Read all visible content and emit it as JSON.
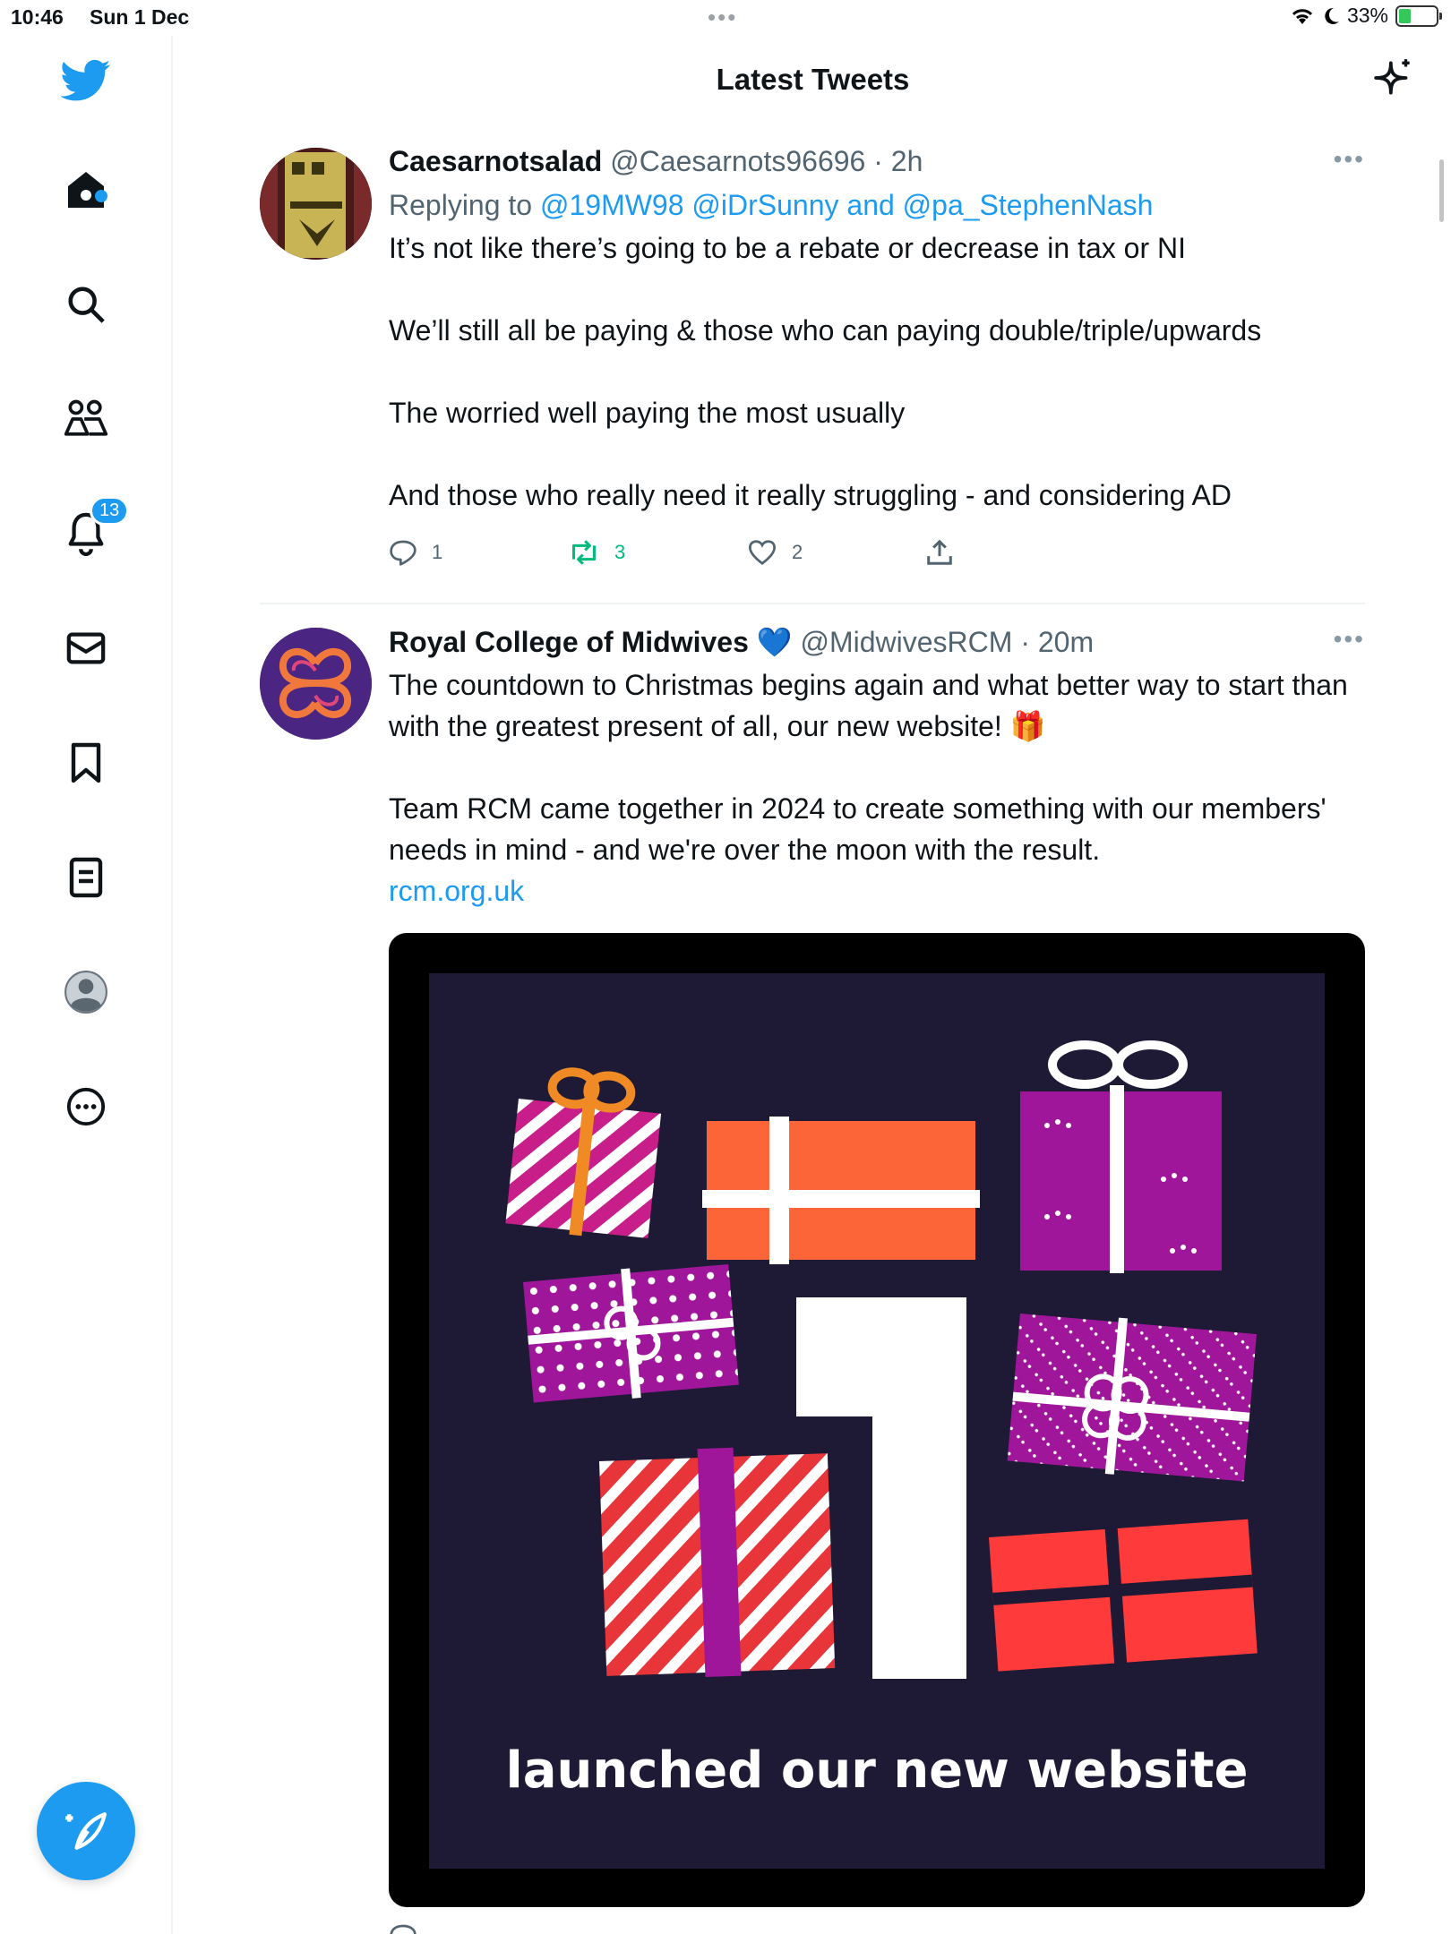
{
  "status": {
    "time": "10:46",
    "date": "Sun 1 Dec",
    "battery": "33%",
    "battery_level": 0.33
  },
  "sidebar": {
    "items": [
      {
        "icon": "twitter-logo-icon"
      },
      {
        "icon": "home-icon",
        "has_dot": true
      },
      {
        "icon": "search-icon"
      },
      {
        "icon": "communities-icon"
      },
      {
        "icon": "notifications-icon",
        "badge": "13"
      },
      {
        "icon": "messages-icon"
      },
      {
        "icon": "bookmarks-icon"
      },
      {
        "icon": "lists-icon"
      },
      {
        "icon": "profile-icon"
      },
      {
        "icon": "more-icon"
      }
    ],
    "compose_icon": "compose-tweet-icon"
  },
  "header": {
    "title": "Latest Tweets",
    "sparkle_icon": "sparkle-icon"
  },
  "tweets": [
    {
      "name": "Caesarnotsalad",
      "handle": "@Caesarnots96696",
      "time": "· 2h",
      "replying_to_prefix": "Replying to ",
      "replying_to": "@19MW98 @iDrSunny and @pa_StephenNash",
      "text": "It’s not like there’s going to be a rebate or decrease in tax or NI\n\nWe’ll still all be paying & those who can paying double/triple/upwards\n\nThe worried well paying the most usually\n\nAnd those who really need it really struggling - and considering AD",
      "replies": "1",
      "retweets": "3",
      "likes": "2"
    },
    {
      "name": "Royal College of Midwives",
      "verified_emoji": "💙",
      "handle": "@MidwivesRCM",
      "time": "· 20m",
      "text": "The countdown to Christmas begins again and what better way to start than with the greatest present of all, our new website! 🎁\n\nTeam RCM came together in 2024 to create something with our members' needs in mind - and we're over the moon with the result.",
      "link": "rcm.org.uk",
      "image_caption": "launched our new website",
      "image_number": "1"
    }
  ],
  "colors": {
    "accent": "#1d9bf0",
    "retweet": "#00ba7c",
    "muted": "#536471",
    "media_bg": "#1e1a35"
  }
}
